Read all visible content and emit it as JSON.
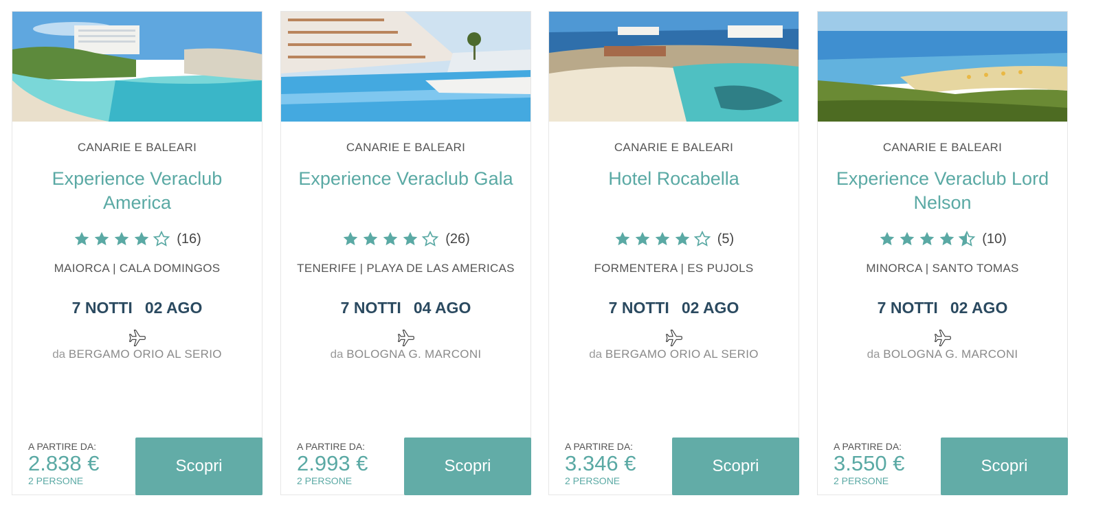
{
  "accent_color": "#5aa9a4",
  "cards": [
    {
      "region": "CANARIE E BALEARI",
      "name": "Experience Veraclub America",
      "rating_stars": 4,
      "review_count": "(16)",
      "location": "MAIORCA | CALA DOMINGOS",
      "nights": "7 NOTTI",
      "date": "02 AGO",
      "from_prefix": "da",
      "airport": "BERGAMO ORIO AL SERIO",
      "price_label": "A PARTIRE DA:",
      "price": "2.838 €",
      "persons": "2 PERSONE",
      "button": "Scopri"
    },
    {
      "region": "CANARIE E BALEARI",
      "name": "Experience Veraclub Gala",
      "rating_stars": 4,
      "review_count": "(26)",
      "location": "TENERIFE | PLAYA DE LAS AMERICAS",
      "nights": "7 NOTTI",
      "date": "04 AGO",
      "from_prefix": "da",
      "airport": "BOLOGNA G. MARCONI",
      "price_label": "A PARTIRE DA:",
      "price": "2.993 €",
      "persons": "2 PERSONE",
      "button": "Scopri"
    },
    {
      "region": "CANARIE E BALEARI",
      "name": "Hotel Rocabella",
      "rating_stars": 4,
      "review_count": "(5)",
      "location": "FORMENTERA | ES PUJOLS",
      "nights": "7 NOTTI",
      "date": "02 AGO",
      "from_prefix": "da",
      "airport": "BERGAMO ORIO AL SERIO",
      "price_label": "A PARTIRE DA:",
      "price": "3.346 €",
      "persons": "2 PERSONE",
      "button": "Scopri"
    },
    {
      "region": "CANARIE E BALEARI",
      "name": "Experience Veraclub Lord Nelson",
      "rating_stars": 4.5,
      "review_count": "(10)",
      "location": "MINORCA | SANTO TOMAS",
      "nights": "7 NOTTI",
      "date": "02 AGO",
      "from_prefix": "da",
      "airport": "BOLOGNA G. MARCONI",
      "price_label": "A PARTIRE DA:",
      "price": "3.550 €",
      "persons": "2 PERSONE",
      "button": "Scopri"
    }
  ]
}
